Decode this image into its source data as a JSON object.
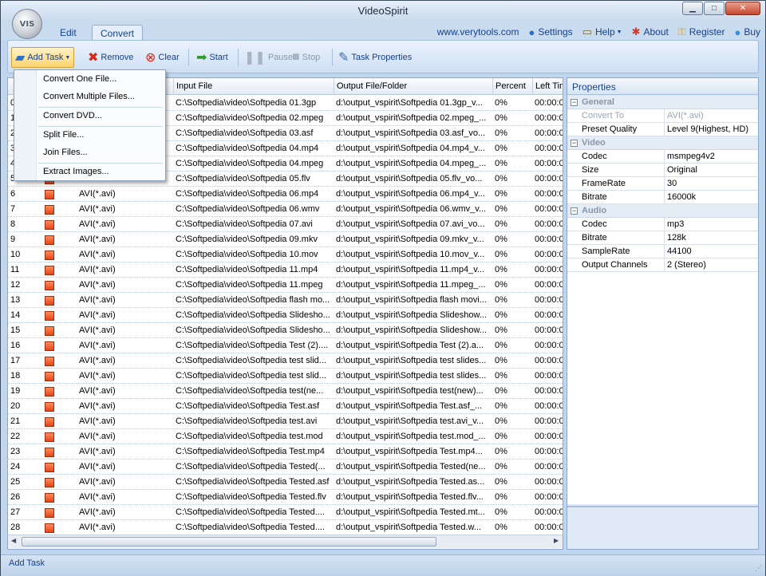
{
  "window": {
    "title": "VideoSpirit",
    "logo_text": "VIS"
  },
  "tabs": [
    {
      "label": "Edit",
      "active": false
    },
    {
      "label": "Convert",
      "active": true
    }
  ],
  "toplinks": {
    "website": "www.verytools.com",
    "settings": "Settings",
    "help": "Help",
    "about": "About",
    "register": "Register",
    "buy": "Buy"
  },
  "toolbar": {
    "add_task": "Add Task",
    "remove": "Remove",
    "clear": "Clear",
    "start": "Start",
    "pause": "Pause",
    "stop": "Stop",
    "task_properties": "Task Properties"
  },
  "menu": {
    "items": [
      "Convert One File...",
      "Convert Multiple Files...",
      "Convert DVD...",
      "Split File...",
      "Join Files...",
      "Extract Images..."
    ]
  },
  "grid": {
    "columns": [
      "",
      "",
      "",
      "Input File",
      "Output File/Folder",
      "Percent",
      "Left Tim"
    ],
    "rows": [
      {
        "num": "0",
        "format": "",
        "input": "C:\\Softpedia\\video\\Softpedia 01.3gp",
        "output": "d:\\output_vspirit\\Softpedia 01.3gp_v...",
        "percent": "0%",
        "left": "00:00:0"
      },
      {
        "num": "1",
        "format": "",
        "input": "C:\\Softpedia\\video\\Softpedia 02.mpeg",
        "output": "d:\\output_vspirit\\Softpedia 02.mpeg_...",
        "percent": "0%",
        "left": "00:00:0"
      },
      {
        "num": "2",
        "format": "",
        "input": "C:\\Softpedia\\video\\Softpedia 03.asf",
        "output": "d:\\output_vspirit\\Softpedia 03.asf_vo...",
        "percent": "0%",
        "left": "00:00:0"
      },
      {
        "num": "3",
        "format": "",
        "input": "C:\\Softpedia\\video\\Softpedia 04.mp4",
        "output": "d:\\output_vspirit\\Softpedia 04.mp4_v...",
        "percent": "0%",
        "left": "00:00:0"
      },
      {
        "num": "4",
        "format": "",
        "input": "C:\\Softpedia\\video\\Softpedia 04.mpeg",
        "output": "d:\\output_vspirit\\Softpedia 04.mpeg_...",
        "percent": "0%",
        "left": "00:00:0"
      },
      {
        "num": "5",
        "format": "",
        "input": "C:\\Softpedia\\video\\Softpedia 05.flv",
        "output": "d:\\output_vspirit\\Softpedia 05.flv_vo...",
        "percent": "0%",
        "left": "00:00:0"
      },
      {
        "num": "6",
        "format": "AVI(*.avi)",
        "input": "C:\\Softpedia\\video\\Softpedia 06.mp4",
        "output": "d:\\output_vspirit\\Softpedia 06.mp4_v...",
        "percent": "0%",
        "left": "00:00:0"
      },
      {
        "num": "7",
        "format": "AVI(*.avi)",
        "input": "C:\\Softpedia\\video\\Softpedia 06.wmv",
        "output": "d:\\output_vspirit\\Softpedia 06.wmv_v...",
        "percent": "0%",
        "left": "00:00:0"
      },
      {
        "num": "8",
        "format": "AVI(*.avi)",
        "input": "C:\\Softpedia\\video\\Softpedia 07.avi",
        "output": "d:\\output_vspirit\\Softpedia 07.avi_vo...",
        "percent": "0%",
        "left": "00:00:0"
      },
      {
        "num": "9",
        "format": "AVI(*.avi)",
        "input": "C:\\Softpedia\\video\\Softpedia 09.mkv",
        "output": "d:\\output_vspirit\\Softpedia 09.mkv_v...",
        "percent": "0%",
        "left": "00:00:0"
      },
      {
        "num": "10",
        "format": "AVI(*.avi)",
        "input": "C:\\Softpedia\\video\\Softpedia 10.mov",
        "output": "d:\\output_vspirit\\Softpedia 10.mov_v...",
        "percent": "0%",
        "left": "00:00:0"
      },
      {
        "num": "11",
        "format": "AVI(*.avi)",
        "input": "C:\\Softpedia\\video\\Softpedia 11.mp4",
        "output": "d:\\output_vspirit\\Softpedia 11.mp4_v...",
        "percent": "0%",
        "left": "00:00:0"
      },
      {
        "num": "12",
        "format": "AVI(*.avi)",
        "input": "C:\\Softpedia\\video\\Softpedia 11.mpeg",
        "output": "d:\\output_vspirit\\Softpedia 11.mpeg_...",
        "percent": "0%",
        "left": "00:00:0"
      },
      {
        "num": "13",
        "format": "AVI(*.avi)",
        "input": "C:\\Softpedia\\video\\Softpedia flash mo...",
        "output": "d:\\output_vspirit\\Softpedia flash movi...",
        "percent": "0%",
        "left": "00:00:0"
      },
      {
        "num": "14",
        "format": "AVI(*.avi)",
        "input": "C:\\Softpedia\\video\\Softpedia Slidesho...",
        "output": "d:\\output_vspirit\\Softpedia Slideshow...",
        "percent": "0%",
        "left": "00:00:0"
      },
      {
        "num": "15",
        "format": "AVI(*.avi)",
        "input": "C:\\Softpedia\\video\\Softpedia Slidesho...",
        "output": "d:\\output_vspirit\\Softpedia Slideshow...",
        "percent": "0%",
        "left": "00:00:0"
      },
      {
        "num": "16",
        "format": "AVI(*.avi)",
        "input": "C:\\Softpedia\\video\\Softpedia Test (2)....",
        "output": "d:\\output_vspirit\\Softpedia Test (2).a...",
        "percent": "0%",
        "left": "00:00:0"
      },
      {
        "num": "17",
        "format": "AVI(*.avi)",
        "input": "C:\\Softpedia\\video\\Softpedia test slid...",
        "output": "d:\\output_vspirit\\Softpedia test slides...",
        "percent": "0%",
        "left": "00:00:0"
      },
      {
        "num": "18",
        "format": "AVI(*.avi)",
        "input": "C:\\Softpedia\\video\\Softpedia test slid...",
        "output": "d:\\output_vspirit\\Softpedia test slides...",
        "percent": "0%",
        "left": "00:00:0"
      },
      {
        "num": "19",
        "format": "AVI(*.avi)",
        "input": "C:\\Softpedia\\video\\Softpedia test(ne...",
        "output": "d:\\output_vspirit\\Softpedia test(new)...",
        "percent": "0%",
        "left": "00:00:0"
      },
      {
        "num": "20",
        "format": "AVI(*.avi)",
        "input": "C:\\Softpedia\\video\\Softpedia Test.asf",
        "output": "d:\\output_vspirit\\Softpedia Test.asf_...",
        "percent": "0%",
        "left": "00:00:0"
      },
      {
        "num": "21",
        "format": "AVI(*.avi)",
        "input": "C:\\Softpedia\\video\\Softpedia test.avi",
        "output": "d:\\output_vspirit\\Softpedia test.avi_v...",
        "percent": "0%",
        "left": "00:00:0"
      },
      {
        "num": "22",
        "format": "AVI(*.avi)",
        "input": "C:\\Softpedia\\video\\Softpedia test.mod",
        "output": "d:\\output_vspirit\\Softpedia test.mod_...",
        "percent": "0%",
        "left": "00:00:0"
      },
      {
        "num": "23",
        "format": "AVI(*.avi)",
        "input": "C:\\Softpedia\\video\\Softpedia Test.mp4",
        "output": "d:\\output_vspirit\\Softpedia Test.mp4...",
        "percent": "0%",
        "left": "00:00:0"
      },
      {
        "num": "24",
        "format": "AVI(*.avi)",
        "input": "C:\\Softpedia\\video\\Softpedia Tested(...",
        "output": "d:\\output_vspirit\\Softpedia Tested(ne...",
        "percent": "0%",
        "left": "00:00:0"
      },
      {
        "num": "25",
        "format": "AVI(*.avi)",
        "input": "C:\\Softpedia\\video\\Softpedia Tested.asf",
        "output": "d:\\output_vspirit\\Softpedia Tested.as...",
        "percent": "0%",
        "left": "00:00:0"
      },
      {
        "num": "26",
        "format": "AVI(*.avi)",
        "input": "C:\\Softpedia\\video\\Softpedia Tested.flv",
        "output": "d:\\output_vspirit\\Softpedia Tested.flv...",
        "percent": "0%",
        "left": "00:00:0"
      },
      {
        "num": "27",
        "format": "AVI(*.avi)",
        "input": "C:\\Softpedia\\video\\Softpedia Tested....",
        "output": "d:\\output_vspirit\\Softpedia Tested.mt...",
        "percent": "0%",
        "left": "00:00:0"
      },
      {
        "num": "28",
        "format": "AVI(*.avi)",
        "input": "C:\\Softpedia\\video\\Softpedia Tested....",
        "output": "d:\\output_vspirit\\Softpedia Tested.w...",
        "percent": "0%",
        "left": "00:00:0"
      }
    ]
  },
  "properties": {
    "title": "Properties",
    "sections": [
      {
        "name": "General",
        "rows": [
          {
            "label": "Convert To",
            "value": "AVI(*.avi)",
            "dim": true
          },
          {
            "label": "Preset Quality",
            "value": "Level 9(Highest, HD)",
            "dim": false
          }
        ]
      },
      {
        "name": "Video",
        "rows": [
          {
            "label": "Codec",
            "value": "msmpeg4v2",
            "dim": false
          },
          {
            "label": "Size",
            "value": "Original",
            "dim": false
          },
          {
            "label": "FrameRate",
            "value": "30",
            "dim": false
          },
          {
            "label": "Bitrate",
            "value": "16000k",
            "dim": false
          }
        ]
      },
      {
        "name": "Audio",
        "rows": [
          {
            "label": "Codec",
            "value": "mp3",
            "dim": false
          },
          {
            "label": "Bitrate",
            "value": "128k",
            "dim": false
          },
          {
            "label": "SampleRate",
            "value": "44100",
            "dim": false
          },
          {
            "label": "Output Channels",
            "value": "2 (Stereo)",
            "dim": false
          }
        ]
      }
    ]
  },
  "statusbar": {
    "text": "Add Task"
  },
  "colors": {
    "accent": "#15428b",
    "status_box": "#e2461a",
    "highlight": "#ffd46e"
  }
}
